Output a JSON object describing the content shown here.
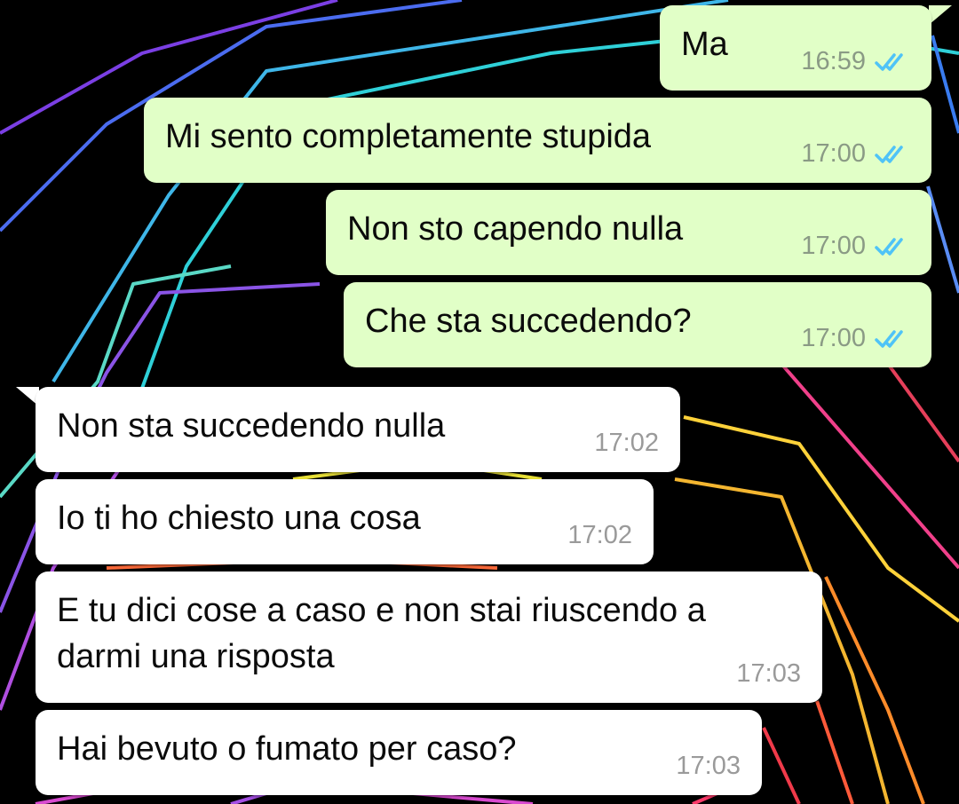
{
  "colors": {
    "outgoing_bubble": "#e1ffc7",
    "incoming_bubble": "#ffffff",
    "read_ticks": "#4fc3f7",
    "wallpaper_bg": "#000000"
  },
  "messages": [
    {
      "direction": "outgoing",
      "text": "Ma",
      "time": "16:59",
      "status": "read"
    },
    {
      "direction": "outgoing",
      "text": "Mi sento completamente stupida",
      "time": "17:00",
      "status": "read"
    },
    {
      "direction": "outgoing",
      "text": "Non sto capendo nulla",
      "time": "17:00",
      "status": "read"
    },
    {
      "direction": "outgoing",
      "text": "Che sta succedendo?",
      "time": "17:00",
      "status": "read"
    },
    {
      "direction": "incoming",
      "text": "Non sta succedendo nulla",
      "time": "17:02"
    },
    {
      "direction": "incoming",
      "text": "Io ti ho chiesto una cosa",
      "time": "17:02"
    },
    {
      "direction": "incoming",
      "text": "E tu dici cose a caso e non stai riuscendo a\ndarmi una risposta",
      "time": "17:03"
    },
    {
      "direction": "incoming",
      "text": "Hai bevuto o fumato per caso?",
      "time": "17:03"
    }
  ]
}
